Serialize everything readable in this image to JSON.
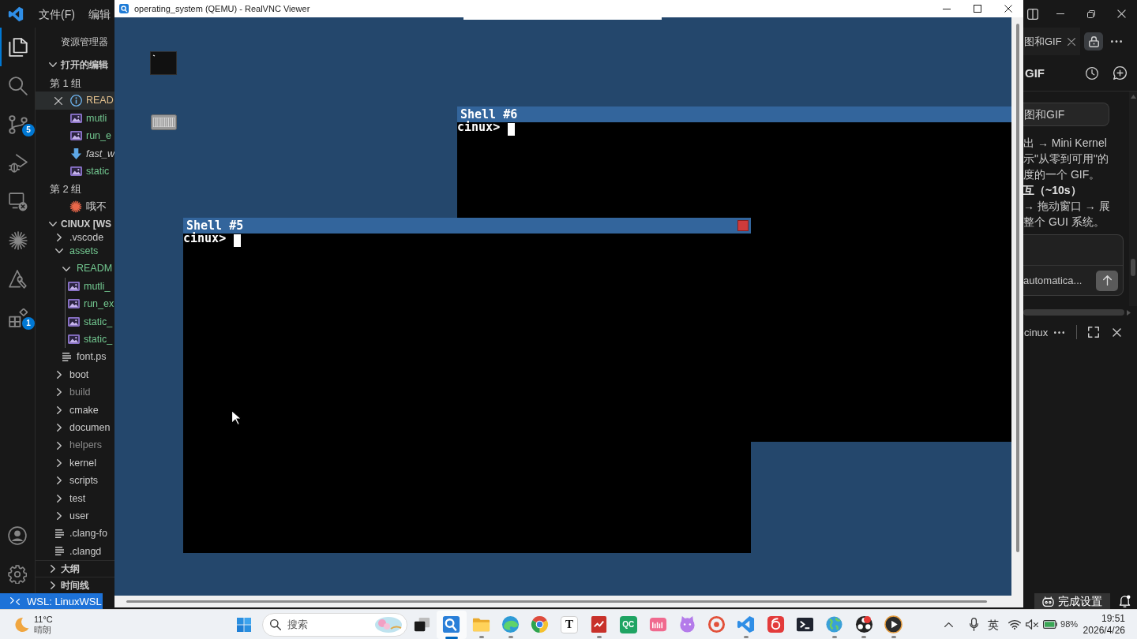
{
  "vscode": {
    "menu": [
      {
        "label": "文件(F)"
      },
      {
        "label": "编辑"
      }
    ],
    "activity_bar": [
      {
        "selected": true
      },
      {
        "selected": false
      },
      {
        "selected": false,
        "badge": "5"
      },
      {
        "selected": false
      },
      {
        "selected": false
      },
      {
        "selected": false
      },
      {
        "selected": false
      },
      {
        "selected": false,
        "badge": "1"
      }
    ],
    "explorer": {
      "title": "资源管理器",
      "open_editors": {
        "title": "打开的编辑",
        "expanded": true,
        "groups": [
          {
            "title": "第 1 组",
            "files": [
              {
                "name": "READ",
                "kind": "preview",
                "color": "#e2c08d",
                "preview": false,
                "selected": true
              },
              {
                "name": "mutli",
                "kind": "image",
                "color": "#73c991",
                "preview": false,
                "selected": false
              },
              {
                "name": "run_e",
                "kind": "image",
                "color": "#73c991",
                "preview": false,
                "selected": false
              },
              {
                "name": "fast_w",
                "kind": "download",
                "color": "#cccccc",
                "preview": true,
                "selected": false
              },
              {
                "name": "static",
                "kind": "image",
                "color": "#73c991",
                "preview": false,
                "selected": false
              }
            ]
          },
          {
            "title": "第 2 组",
            "files": [
              {
                "name": "哦不",
                "kind": "chat",
                "color": "#cccccc",
                "preview": false,
                "selected": false
              }
            ]
          }
        ]
      },
      "folder": {
        "title": "CINUX [WS",
        "expanded": true,
        "tree": [
          {
            "name": ".vscode",
            "kind": "folder",
            "color": "#cccccc",
            "expanded": false,
            "selected": false
          },
          {
            "name": "assets",
            "kind": "folder",
            "color": "#73c991",
            "expanded": true,
            "selected": false,
            "children": [
              {
                "name": "READM",
                "kind": "folder",
                "color": "#73c991",
                "expanded": true,
                "selected": false,
                "children": [
                  {
                    "name": "mutli_",
                    "kind": "image",
                    "color": "#73c991",
                    "selected": false
                  },
                  {
                    "name": "run_ex",
                    "kind": "image",
                    "color": "#73c991",
                    "selected": false
                  },
                  {
                    "name": "static_",
                    "kind": "image",
                    "color": "#73c991",
                    "selected": false
                  },
                  {
                    "name": "static_",
                    "kind": "image",
                    "color": "#73c991",
                    "selected": false
                  }
                ]
              },
              {
                "name": "font.ps",
                "kind": "text",
                "color": "#cccccc",
                "selected": false
              }
            ]
          },
          {
            "name": "boot",
            "kind": "folder",
            "color": "#cccccc",
            "expanded": false,
            "selected": false
          },
          {
            "name": "build",
            "kind": "folder",
            "color": "#8c8c8c",
            "expanded": false,
            "selected": false
          },
          {
            "name": "cmake",
            "kind": "folder",
            "color": "#cccccc",
            "expanded": false,
            "selected": false
          },
          {
            "name": "documen",
            "kind": "folder",
            "color": "#cccccc",
            "expanded": false,
            "selected": false
          },
          {
            "name": "helpers",
            "kind": "folder",
            "color": "#8c8c8c",
            "expanded": false,
            "selected": false
          },
          {
            "name": "kernel",
            "kind": "folder",
            "color": "#cccccc",
            "expanded": false,
            "selected": false
          },
          {
            "name": "scripts",
            "kind": "folder",
            "color": "#cccccc",
            "expanded": false,
            "selected": false
          },
          {
            "name": "test",
            "kind": "folder",
            "color": "#cccccc",
            "expanded": false,
            "selected": false
          },
          {
            "name": "user",
            "kind": "folder",
            "color": "#cccccc",
            "expanded": false,
            "selected": false
          },
          {
            "name": ".clang-fo",
            "kind": "text",
            "color": "#cccccc",
            "selected": false
          },
          {
            "name": ".clangd",
            "kind": "text",
            "color": "#cccccc",
            "selected": false
          }
        ]
      },
      "panels": [
        {
          "title": "大纲",
          "expanded": false
        },
        {
          "title": "时间线",
          "expanded": false
        }
      ]
    },
    "chat": {
      "tab": {
        "label": "图和GIF",
        "selected": true
      },
      "title": "GIF",
      "user_message": "图和GIF",
      "reply": [
        {
          "text": "出 → Mini Kernel",
          "bold": false
        },
        {
          "text": "示\"从零到可用\"的",
          "bold": false
        },
        {
          "text": "度的一个 GIF。",
          "bold": false
        },
        {
          "text": "互（~10s）",
          "bold": true
        },
        {
          "text": "→ 拖动窗口 → 展",
          "bold": false
        },
        {
          "text": "整个 GUI 系统。",
          "bold": false
        }
      ],
      "input": {
        "mode": "automatica..."
      },
      "terminal": {
        "label": "cinux"
      }
    },
    "status_bar": {
      "remote": "WSL: LinuxWSL",
      "setup": "完成设置"
    }
  },
  "vnc": {
    "title": "operating_system (QEMU) - RealVNC Viewer",
    "windows": [
      {
        "title": "Shell #6",
        "prompt": "cinux>",
        "close_button": false
      },
      {
        "title": "Shell #5",
        "prompt": "cinux>",
        "close_button": true
      }
    ]
  },
  "taskbar": {
    "weather": {
      "temperature": "11°C",
      "condition": "晴朗"
    },
    "search": {
      "placeholder": "搜索"
    },
    "apps": [
      {
        "running": false,
        "active": false,
        "notification": false
      },
      {
        "running": true,
        "active": true,
        "notification": false
      },
      {
        "running": true,
        "active": false,
        "notification": false
      },
      {
        "running": true,
        "active": false,
        "notification": false
      },
      {
        "running": false,
        "active": false,
        "notification": false
      },
      {
        "label": "T",
        "running": false,
        "active": false,
        "notification": false
      },
      {
        "running": true,
        "active": false,
        "notification": false
      },
      {
        "label": "QC",
        "running": false,
        "active": false,
        "notification": false
      },
      {
        "running": false,
        "active": false,
        "notification": false
      },
      {
        "running": false,
        "active": false,
        "notification": false
      },
      {
        "running": false,
        "active": false,
        "notification": false
      },
      {
        "running": true,
        "active": false,
        "notification": false
      },
      {
        "running": false,
        "active": false,
        "notification": false
      },
      {
        "running": false,
        "active": false,
        "notification": false
      },
      {
        "running": true,
        "active": false,
        "notification": false
      },
      {
        "running": true,
        "active": false,
        "notification": true
      },
      {
        "running": true,
        "active": false,
        "notification": false
      }
    ],
    "tray": {
      "input_method": "英",
      "muted": true,
      "battery": "98%",
      "time": "19:51",
      "date": "2026/4/26"
    }
  }
}
